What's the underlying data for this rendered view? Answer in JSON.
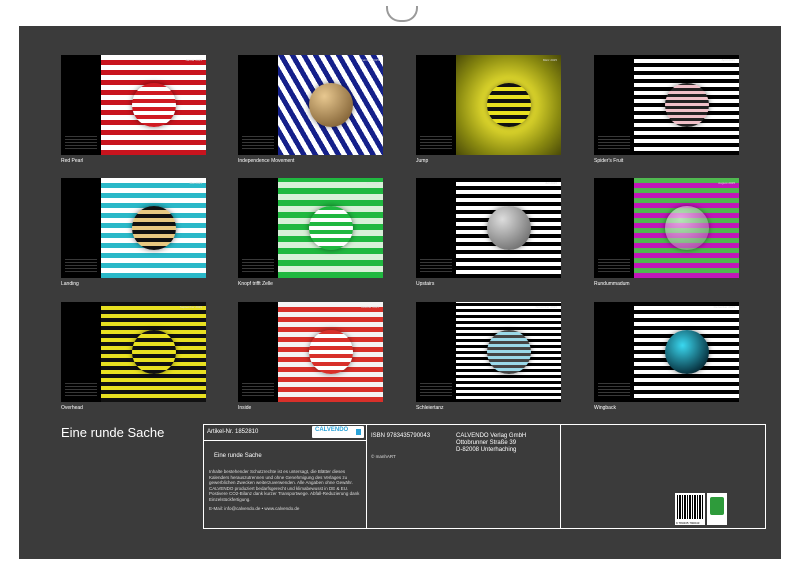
{
  "months": [
    {
      "title": "Januar 2025",
      "caption": "Red Pearl",
      "bg": "repeating-linear-gradient(0deg,#c8141e 0 5px,#ffffff 5px 10px)",
      "ball": "repeating-linear-gradient(0deg,#d01a22 0 4px,#ffffff 4px 8px)"
    },
    {
      "title": "Februar 2025",
      "caption": "Independence Movement",
      "bg": "repeating-linear-gradient(60deg,#15208a 0 5px,#ffffff 5px 10px)",
      "ball": "radial-gradient(circle at 35% 30%,#e8c890,#6a4a20)"
    },
    {
      "title": "März 2025",
      "caption": "Jump",
      "bg": "radial-gradient(circle,#e8e030 0 30%,#8a8a10 70%,#4a4a08)",
      "ball": "repeating-linear-gradient(0deg,#111 0 4px,#e8e020 4px 8px)"
    },
    {
      "title": "April 2025",
      "caption": "Spider's Fruit",
      "bg": "repeating-linear-gradient(0deg,#000 0 4px,#ffffff 4px 8px)",
      "ball": "repeating-linear-gradient(0deg,#222 0 3px,#f0c0c8 3px 6px)"
    },
    {
      "title": "Mai 2025",
      "caption": "Landing",
      "bg": "repeating-linear-gradient(0deg,#2ab8c8 0 5px,#ffffff 5px 10px)",
      "ball": "repeating-linear-gradient(0deg,#111 0 4px,#e8c880 4px 8px)"
    },
    {
      "title": "Juni 2025",
      "caption": "Knopf trifft Zelle",
      "bg": "repeating-linear-gradient(0deg,#20b840 0 6px,#d8f0d8 6px 12px)",
      "ball": "repeating-linear-gradient(0deg,#20b840 0 4px,#ffffff 4px 8px)"
    },
    {
      "title": "Juli 2025",
      "caption": "Upstairs",
      "bg": "repeating-linear-gradient(0deg,#000 0 4px,#ffffff 4px 8px)",
      "ball": "radial-gradient(circle at 35% 30%,#ddd,#555)"
    },
    {
      "title": "August 2025",
      "caption": "Rundummadum",
      "bg": "repeating-linear-gradient(0deg,#c018b8 0 5px,#50b850 5px 10px)",
      "ball": "radial-gradient(circle at 35% 30%,rgba(255,255,255,.6),rgba(120,120,120,.4))"
    },
    {
      "title": "September 2025",
      "caption": "Overhead",
      "bg": "repeating-linear-gradient(0deg,#111 0 4px,#e8e020 4px 8px)",
      "ball": "repeating-linear-gradient(0deg,#111 0 4px,#e8e020 4px 8px)"
    },
    {
      "title": "Oktober 2025",
      "caption": "Inside",
      "bg": "repeating-linear-gradient(0deg,#d8302a 0 5px,#f4f4f4 5px 10px)",
      "ball": "repeating-linear-gradient(0deg,#d8302a 0 4px,#ffffff 4px 8px)"
    },
    {
      "title": "November 2025",
      "caption": "Schleiertanz",
      "bg": "repeating-linear-gradient(0deg,#000 0 3px,#ffffff 3px 6px)",
      "ball": "repeating-linear-gradient(0deg,#444 0 3px,#9ad8e8 3px 6px)"
    },
    {
      "title": "Dezember 2025",
      "caption": "Wingback",
      "bg": "repeating-linear-gradient(0deg,#000 0 4px,#ffffff 4px 8px)",
      "ball": "radial-gradient(circle at 40% 35%,#3ad8f0,#0a3a48 70%,#000)"
    }
  ],
  "product": {
    "title": "Eine runde Sache",
    "article": "Artikel-Nr. 1852810",
    "logo": "CALVENDO",
    "subtitle": "Eine runde Sache",
    "isbn": "ISBN 9783435790043",
    "copyright": "© manhART",
    "publisher": [
      "CALVENDO Verlag GmbH",
      "Ottobrunner Straße 39",
      "D-82008 Unterhaching"
    ],
    "notice": "Inhalte bestehender Schutzrechte ist es untersagt, die Blätter dieses Kalenders herauszutrennen und ohne Genehmigung des Verlages zu gewerblichen Zwecken weiterzuverwenden. Alle Angaben ohne Gewähr. CALVENDO produziert bedarfsgerecht und klimabewusst in DE & EU. Postivere CO2-Bilanz dank kurzer Transportwege. Abfall-Reduzierung dank Einzelstückfertigung.",
    "email": "E-Mail: info@calvendo.de • www.calvendo.de",
    "barcode": "9 783435 790043"
  }
}
